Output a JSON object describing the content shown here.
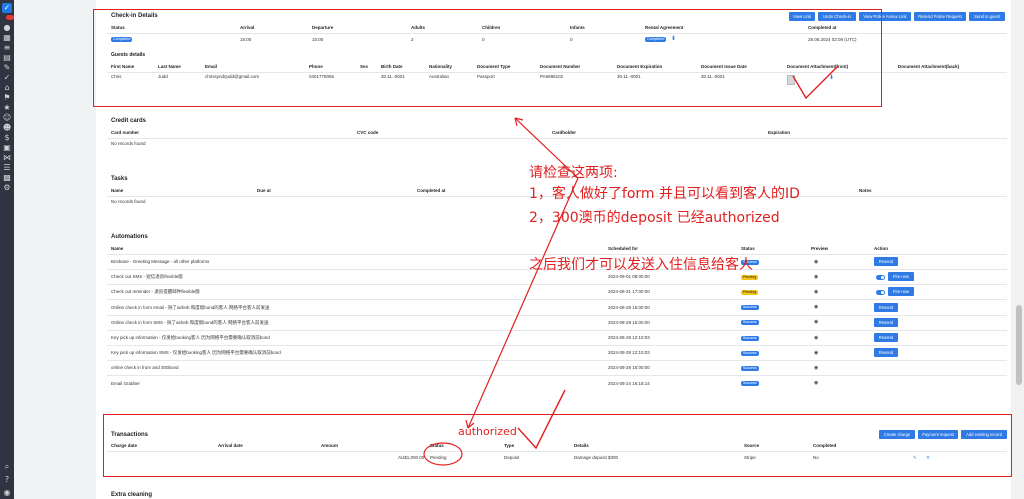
{
  "checkin": {
    "title": "Check-in Details",
    "buttons": [
      "View Link",
      "Undo Check-in",
      "View Police Annex Link",
      "Resend Police Request",
      "Send to guest"
    ],
    "headers": [
      "Status",
      "Arrival",
      "Departure",
      "Adults",
      "Children",
      "Infants",
      "Rental Agreement",
      "Completed at"
    ],
    "status": "Completed",
    "arrival": "15:00",
    "departure": "10:00",
    "adults": "2",
    "children": "0",
    "infants": "0",
    "rental_agreement": "Completed",
    "completed_at": "28.08.2024 02:08 (UTC)"
  },
  "guests": {
    "title": "Guests details",
    "headers": [
      "First Name",
      "Last Name",
      "Email",
      "Phone",
      "Sex",
      "Birth Date",
      "Nationality",
      "Document Type",
      "Document Number",
      "Document Expiration",
      "Document Issue Date",
      "Document Attachment(front)",
      "Document Attachment(back)"
    ],
    "row": [
      "Chris",
      "Judd",
      "chrissyndrjudd@gmail.com",
      "0401775066",
      "",
      "30.11.-0001",
      "Australian",
      "Passport",
      "PA6896102",
      "30.11.-0001",
      "30.11.-0001"
    ]
  },
  "credit_cards": {
    "title": "Credit cards",
    "headers": [
      "Card number",
      "CVC code",
      "Cardholder",
      "Expiration"
    ],
    "empty": "No records found"
  },
  "tasks": {
    "title": "Tasks",
    "headers": [
      "Name",
      "Due at",
      "Completed at",
      "Notes"
    ],
    "empty": "No records found"
  },
  "automations": {
    "title": "Automations",
    "headers": [
      "Name",
      "Scheduled for",
      "Status",
      "Preview",
      "Action"
    ],
    "rows": [
      {
        "name": "Brisbane - Greeting Message - all other platforms",
        "scheduled": "",
        "status": "Success",
        "action": "Resend"
      },
      {
        "name": "Check out SMS - 短信退房flexible版",
        "scheduled": "2024-09-01 08:00:00",
        "status": "Pending",
        "action": "Fire now"
      },
      {
        "name": "Check out reminder - 退房提醒邮件flexible版",
        "scheduled": "2024-08-31 17:00:00",
        "status": "Pending",
        "action": "Fire now"
      },
      {
        "name": "Online check in form email - 除了airbnb 和度假bond的客人 网络平台客人前发送",
        "scheduled": "2024-08-28 15:00:00",
        "status": "Success",
        "action": "Resend"
      },
      {
        "name": "Online check in form SMS - 除了airbnb 和度假bond的客人 网络平台客人前发送",
        "scheduled": "2024-08-28 15:00:00",
        "status": "Success",
        "action": "Resend"
      },
      {
        "name": "Key pick up information - 仅发给booking客人 因为网络平台需要确认取消前bond",
        "scheduled": "2024-08-28 12:10:03",
        "status": "Success",
        "action": "Resend"
      },
      {
        "name": "Key pick up information SMS - 仅发给booking客人 因为网络平台需要确认取消前bond",
        "scheduled": "2024-08-28 12:10:03",
        "status": "Success",
        "action": "Resend"
      },
      {
        "name": "online check in from and 300bond",
        "scheduled": "2024-08-28 15:00:00",
        "status": "Success",
        "action": ""
      },
      {
        "name": "Email Grabber",
        "scheduled": "2024-08-24 16:18:14",
        "status": "Success",
        "action": ""
      }
    ]
  },
  "transactions": {
    "title": "Transactions",
    "buttons": [
      "Create charge",
      "Payment request",
      "Add existing record"
    ],
    "headers": [
      "Charge date",
      "Arrival date",
      "Amount",
      "Status",
      "Type",
      "Details",
      "Source",
      "Completed"
    ],
    "row": {
      "charge_date": "",
      "arrival_date": "",
      "amount": "AU$1,000.00",
      "status": "Pending",
      "type": "Deposit",
      "details": "Damage deposit $300",
      "source": "Stripe",
      "completed": "No"
    }
  },
  "extra_cleaning": {
    "title": "Extra cleaning"
  },
  "annotations": {
    "line1": "请检查这两项:",
    "line2": "1，客人做好了form 并且可以看到客人的ID",
    "line3": "2，300澳币的deposit 已经authorized",
    "line4": "之后我们才可以发送入住信息给客人",
    "authorized": "authorized"
  },
  "colors": {
    "accent": "#2f7ae5",
    "annotation": "#e21f1f",
    "pending": "#f2c318"
  }
}
